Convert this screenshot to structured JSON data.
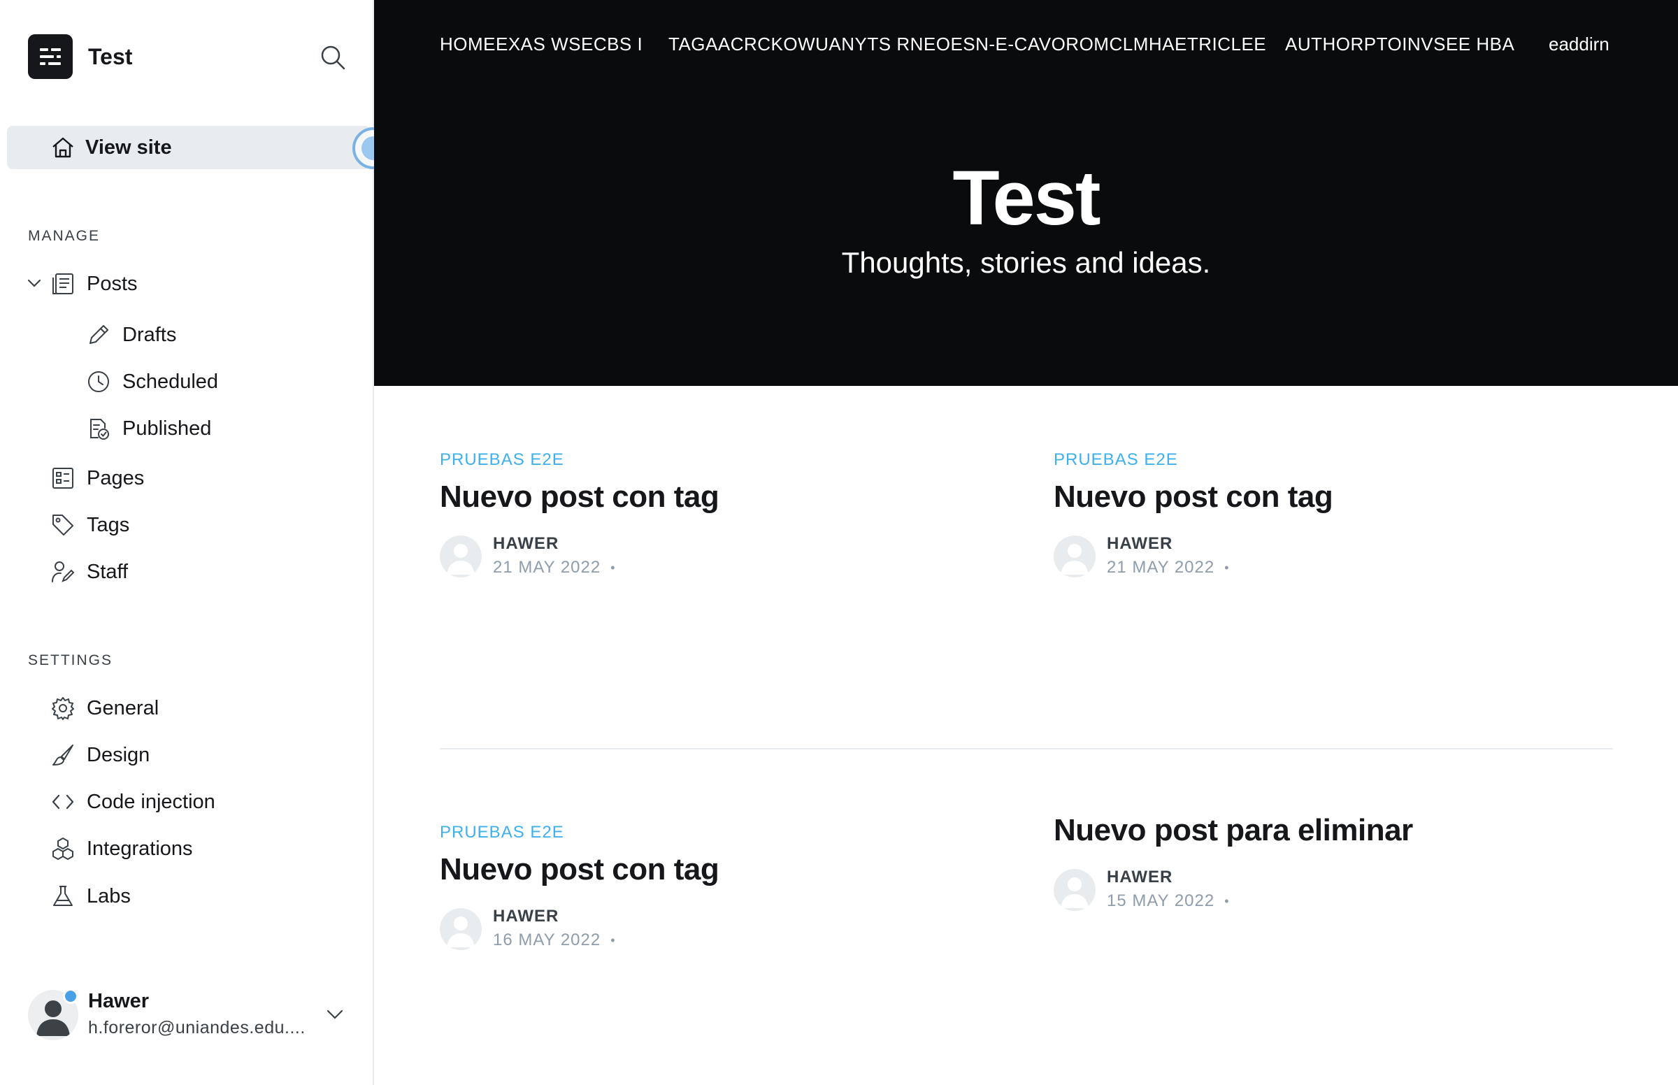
{
  "brand": {
    "title": "Test"
  },
  "sidebar": {
    "view_site": "View site",
    "manage_title": "MANAGE",
    "manage_items": [
      {
        "label": "Posts",
        "icon": "posts-icon"
      },
      {
        "label": "Drafts",
        "icon": "pencil-icon"
      },
      {
        "label": "Scheduled",
        "icon": "clock-icon"
      },
      {
        "label": "Published",
        "icon": "published-icon"
      },
      {
        "label": "Pages",
        "icon": "pages-icon"
      },
      {
        "label": "Tags",
        "icon": "tag-icon"
      },
      {
        "label": "Staff",
        "icon": "staff-icon"
      }
    ],
    "settings_title": "SETTINGS",
    "settings_items": [
      {
        "label": "General",
        "icon": "gear-icon"
      },
      {
        "label": "Design",
        "icon": "brush-icon"
      },
      {
        "label": "Code injection",
        "icon": "code-icon"
      },
      {
        "label": "Integrations",
        "icon": "integrations-icon"
      },
      {
        "label": "Labs",
        "icon": "flask-icon"
      }
    ]
  },
  "user": {
    "name": "Hawer",
    "email": "h.foreror@uniandes.edu...."
  },
  "site": {
    "nav": [
      "HOMEEXAS WSECBS I",
      "TAGAACRCKOWUANYTS RNEOESN-E-CAVOROMCLMHAETRICLEE",
      "AUTHORPTOINVSEE HBA",
      "eaddirn"
    ],
    "title": "Test",
    "subtitle": "Thoughts, stories and ideas."
  },
  "posts": [
    {
      "tag": "PRUEBAS E2E",
      "title": "Nuevo post con tag",
      "author": "HAWER",
      "date": "21 MAY 2022"
    },
    {
      "tag": "PRUEBAS E2E",
      "title": "Nuevo post con tag",
      "author": "HAWER",
      "date": "21 MAY 2022"
    },
    {
      "tag": "PRUEBAS E2E",
      "title": "Nuevo post con tag",
      "author": "HAWER",
      "date": "16 MAY 2022"
    },
    {
      "tag": "",
      "title": "Nuevo post para eliminar",
      "author": "HAWER",
      "date": "15 MAY 2022"
    }
  ],
  "colors": {
    "accent": "#3eb0ef",
    "hero_bg": "#0a0b0c",
    "active_bg": "#e9ecef"
  }
}
